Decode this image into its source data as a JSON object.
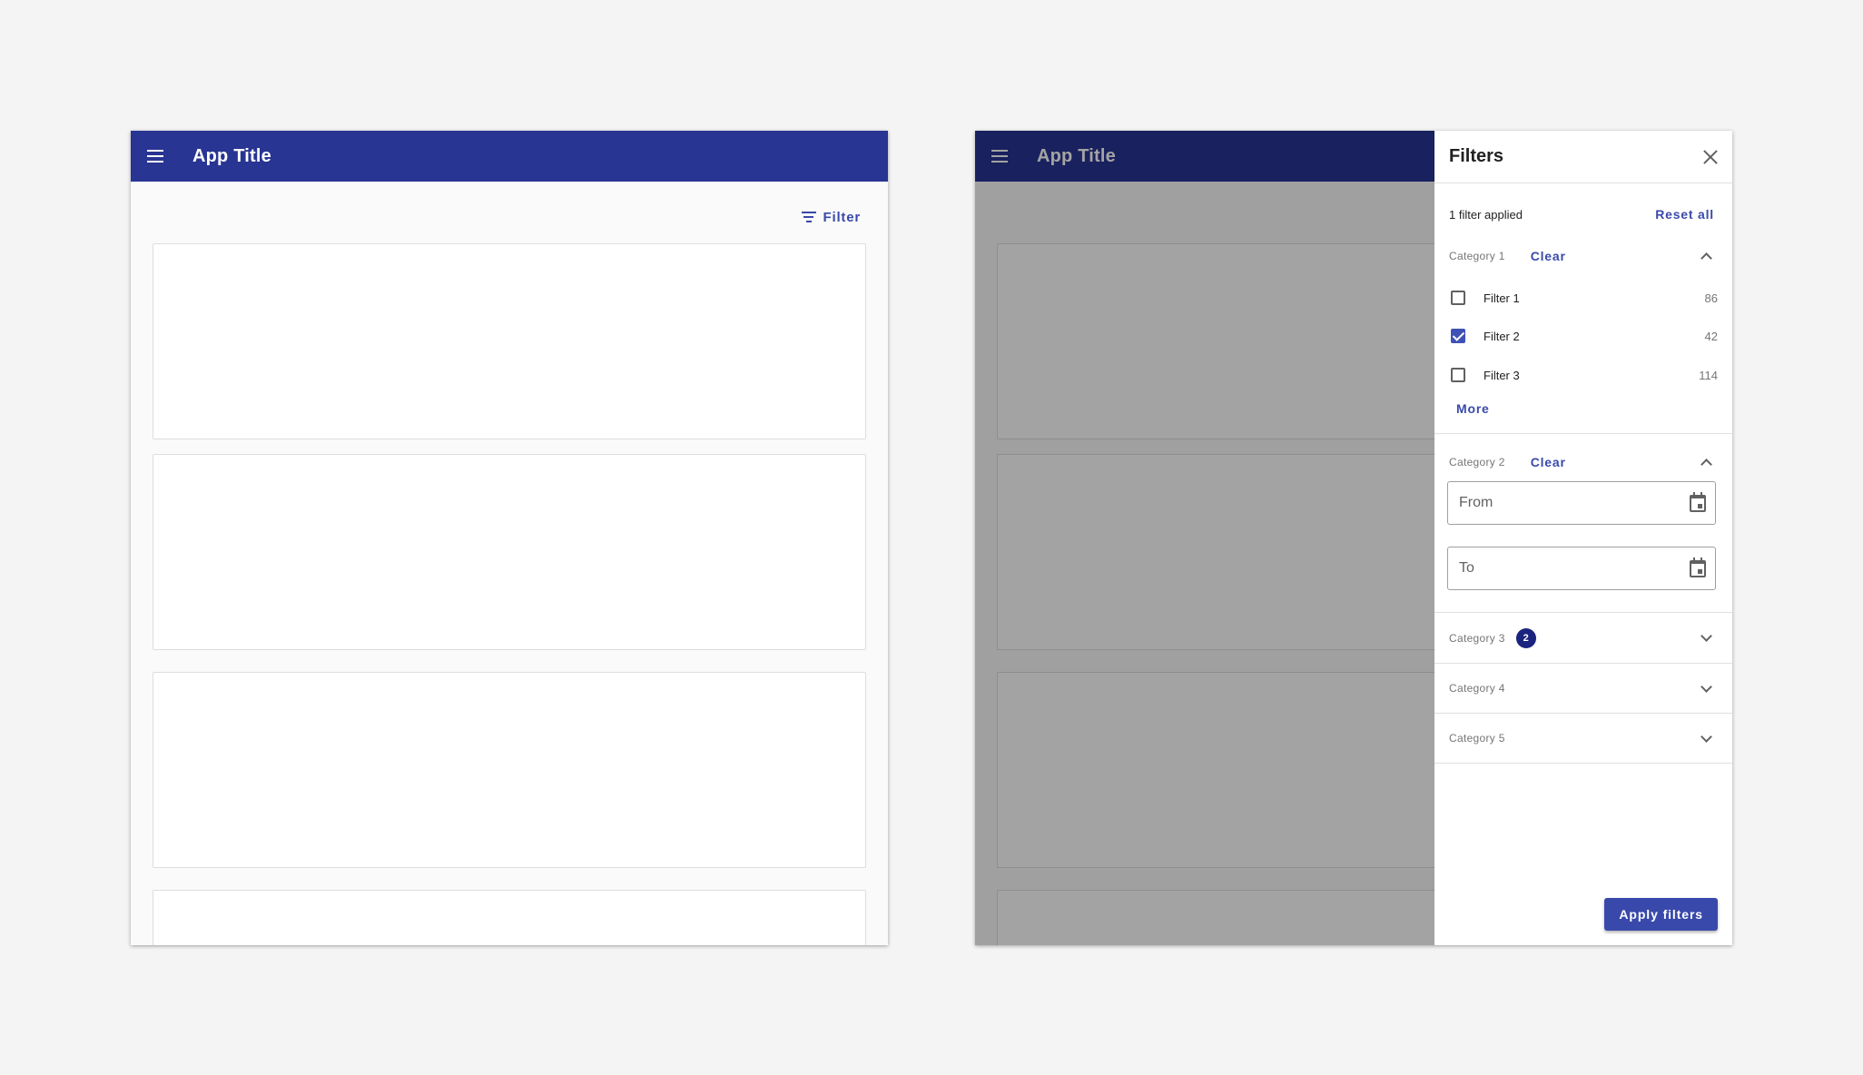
{
  "colors": {
    "primary": "#283593",
    "accent": "#3949ab",
    "badge": "#1a237e",
    "scrim": "rgba(0,0,0,0.36)"
  },
  "left_screen": {
    "appbar": {
      "menu_icon": "menu-icon",
      "title": "App Title"
    },
    "filter_button": {
      "icon": "filter-list-icon",
      "label": "Filter"
    }
  },
  "right_screen": {
    "appbar": {
      "menu_icon": "menu-icon",
      "title": "App Title"
    },
    "filters_panel": {
      "title": "Filters",
      "close_icon": "close-icon",
      "summary": "1 filter applied",
      "reset_label": "Reset all",
      "categories": [
        {
          "label": "Category 1",
          "clear_label": "Clear",
          "expanded": true,
          "options": [
            {
              "label": "Filter 1",
              "count": "86",
              "checked": false
            },
            {
              "label": "Filter 2",
              "count": "42",
              "checked": true
            },
            {
              "label": "Filter 3",
              "count": "114",
              "checked": false
            }
          ],
          "more_label": "More"
        },
        {
          "label": "Category 2",
          "clear_label": "Clear",
          "expanded": true,
          "from_placeholder": "From",
          "to_placeholder": "To",
          "date_icon": "calendar-icon"
        },
        {
          "label": "Category 3",
          "badge": "2",
          "expanded": false
        },
        {
          "label": "Category 4",
          "expanded": false
        },
        {
          "label": "Category 5",
          "expanded": false
        }
      ],
      "apply_label": "Apply filters"
    }
  }
}
